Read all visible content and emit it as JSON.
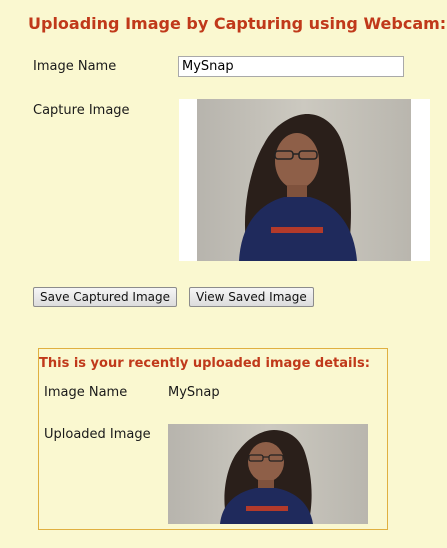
{
  "page": {
    "title": "Uploading Image by Capturing using Webcam:"
  },
  "form": {
    "image_name_label": "Image Name",
    "image_name_value": "MySnap",
    "capture_label": "Capture Image"
  },
  "buttons": {
    "save_label": "Save Captured Image",
    "view_label": "View Saved Image"
  },
  "details": {
    "heading": "This is your recently uploaded image details:",
    "image_name_label": "Image Name",
    "image_name_value": "MySnap",
    "uploaded_label": "Uploaded Image"
  },
  "colors": {
    "background": "#FAF8D0",
    "heading": "#C0391A",
    "box_border": "#E0B040"
  }
}
